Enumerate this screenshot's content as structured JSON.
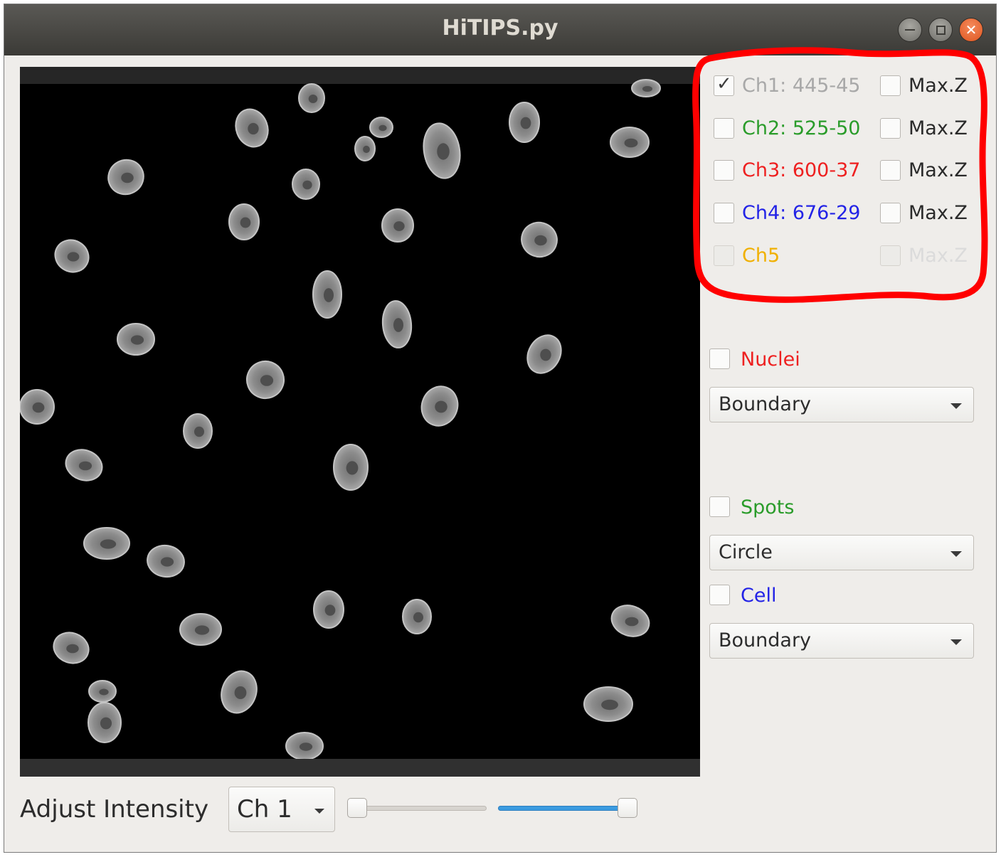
{
  "window": {
    "title": "HiTIPS.py",
    "controls": [
      "minimize-icon",
      "maximize-icon",
      "close-icon"
    ]
  },
  "viewer": {
    "image_kind": "grayscale fluorescence microscopy image of nuclei on black background"
  },
  "channels": [
    {
      "label": "Ch1: 445-45",
      "checked": true,
      "enabled": true,
      "color": "#a8a8a8",
      "maxz_label": "Max.Z",
      "maxz_checked": false,
      "maxz_enabled": true
    },
    {
      "label": "Ch2: 525-50",
      "checked": false,
      "enabled": true,
      "color": "#2a9c2a",
      "maxz_label": "Max.Z",
      "maxz_checked": false,
      "maxz_enabled": true
    },
    {
      "label": "Ch3: 600-37",
      "checked": false,
      "enabled": true,
      "color": "#ee2020",
      "maxz_label": "Max.Z",
      "maxz_checked": false,
      "maxz_enabled": true
    },
    {
      "label": "Ch4: 676-29",
      "checked": false,
      "enabled": true,
      "color": "#2323e6",
      "maxz_label": "Max.Z",
      "maxz_checked": false,
      "maxz_enabled": true
    },
    {
      "label": "Ch5",
      "checked": false,
      "enabled": false,
      "color": "#f0b000",
      "maxz_label": "Max.Z",
      "maxz_checked": false,
      "maxz_enabled": false
    }
  ],
  "highlight_color": "#ff0000",
  "overlays": {
    "nuclei": {
      "label": "Nuclei",
      "checked": false,
      "color": "#ee2020",
      "mode": "Boundary"
    },
    "spots": {
      "label": "Spots",
      "checked": false,
      "color": "#2a9c2a",
      "mode": "Circle"
    },
    "cell": {
      "label": "Cell",
      "checked": false,
      "color": "#2323e6",
      "mode": "Boundary"
    }
  },
  "intensity": {
    "label": "Adjust Intensity",
    "channel": "Ch 1",
    "min_slider_fraction": 0.0,
    "max_slider_fraction": 1.0
  }
}
